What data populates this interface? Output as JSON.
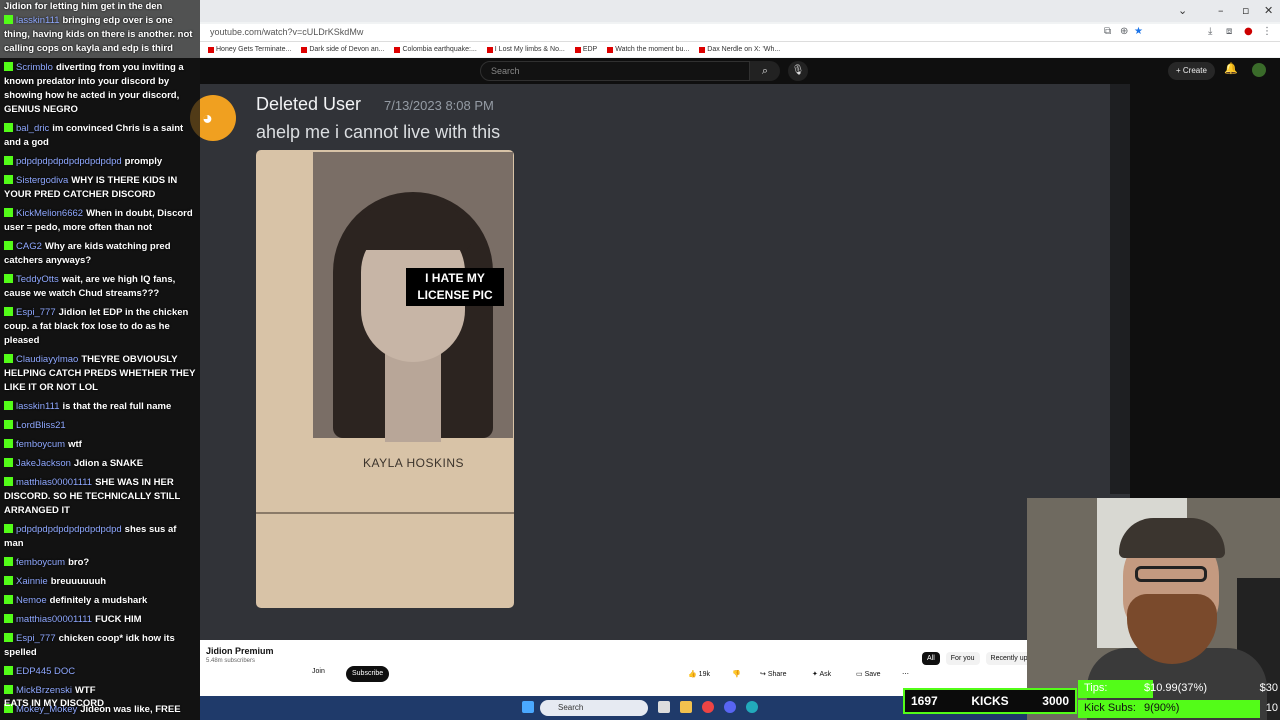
{
  "browser": {
    "url": "youtube.com/watch?v=cULDrKSkdMw",
    "bookmarks": [
      "Honey Gets Terminate...",
      "Dark side of Devon an...",
      "Colombia earthquake:...",
      "I Lost My limbs & No...",
      "EDP",
      "Watch the moment bu...",
      "Dax Nerdle on X: 'Wh..."
    ]
  },
  "youtube": {
    "search_placeholder": "Search",
    "create_label": "+ Create",
    "channel_title": "Jidion Premium",
    "subscribers": "5.48m subscribers",
    "join_label": "Join",
    "subscribe_label": "Subscribe",
    "actions": {
      "likes": "19k",
      "share": "Share",
      "ask": "Ask",
      "save": "Save"
    },
    "filter_chips": [
      "All",
      "For you",
      "Recently up"
    ]
  },
  "discord_message": {
    "user": "Deleted User",
    "timestamp": "7/13/2023 8:08 PM",
    "text": "ahelp me i cannot live with this",
    "caption": "I HATE MY LICENSE PIC",
    "card_name": "KAYLA HOSKINS"
  },
  "chat": {
    "top_line": "Jidion for letting him get in the den",
    "messages": [
      {
        "user": "lasskin111",
        "text": "bringing edp over is one thing, having kids on there is another. not calling cops on kayla and edp is third"
      },
      {
        "user": "Scrimblo",
        "text": "diverting from you inviting a known predator into your discord by showing how he acted in your discord, GENIUS NEGRO"
      },
      {
        "user": "bal_dric",
        "text": "im convinced Chris is a saint and a god"
      },
      {
        "user": "pdpdpdpdpdpdpdpdpdpd",
        "text": "promply"
      },
      {
        "user": "Sistergodiva",
        "text": "WHY IS THERE KIDS IN YOUR PRED CATCHER DISCORD"
      },
      {
        "user": "KickMelion6662",
        "text": "When in doubt, Discord user = pedo, more often than not"
      },
      {
        "user": "CAG2",
        "text": "Why are kids watching pred catchers anyways?"
      },
      {
        "user": "TeddyOtts",
        "text": "wait, are we high IQ fans, cause we watch Chud streams???"
      },
      {
        "user": "Espi_777",
        "text": "Jidion let EDP in the chicken coup. a fat black fox lose to do as he pleased"
      },
      {
        "user": "Claudiayylmao",
        "text": "THEYRE OBVIOUSLY HELPING CATCH PREDS WHETHER THEY LIKE IT OR NOT LOL"
      },
      {
        "user": "lasskin111",
        "text": "is that the real full name"
      },
      {
        "user": "LordBliss21",
        "text": ""
      },
      {
        "user": "femboycum",
        "text": "wtf"
      },
      {
        "user": "JakeJackson",
        "text": "Jdion a SNAKE"
      },
      {
        "user": "matthias00001111",
        "text": "SHE WAS IN HER DISCORD. SO HE TECHNICALLY STILL ARRANGED IT"
      },
      {
        "user": "pdpdpdpdpdpdpdpdpdpd",
        "text": "shes sus af man"
      },
      {
        "user": "femboycum",
        "text": "bro?"
      },
      {
        "user": "Xainnie",
        "text": "breuuuuuuh"
      },
      {
        "user": "Nemoe",
        "text": "definitely a mudshark"
      },
      {
        "user": "matthias00001111",
        "text": "FUCK HIM"
      },
      {
        "user": "Espi_777",
        "text": "chicken coop* idk how its spelled"
      },
      {
        "user": "EDP445 DOC",
        "text": ""
      },
      {
        "user": "MickBrzenski",
        "text": "WTF"
      },
      {
        "user": "Mokey_Mokey",
        "text": "Jideon was like, FREE"
      }
    ],
    "footer": "EATS IN MY DISCORD"
  },
  "overlay": {
    "kicks_current": "1697",
    "kicks_label": "KICKS",
    "kicks_goal": "3000",
    "tips_label": "Tips:",
    "tips_value": "$10.99(37%)",
    "tips_goal": "$30",
    "tips_progress": 0.37,
    "subs_label": "Kick Subs:",
    "subs_value": "9(90%)",
    "subs_goal": "10",
    "subs_progress": 0.9,
    "accent": "#53fc18"
  },
  "taskbar": {
    "search_label": "Search"
  }
}
